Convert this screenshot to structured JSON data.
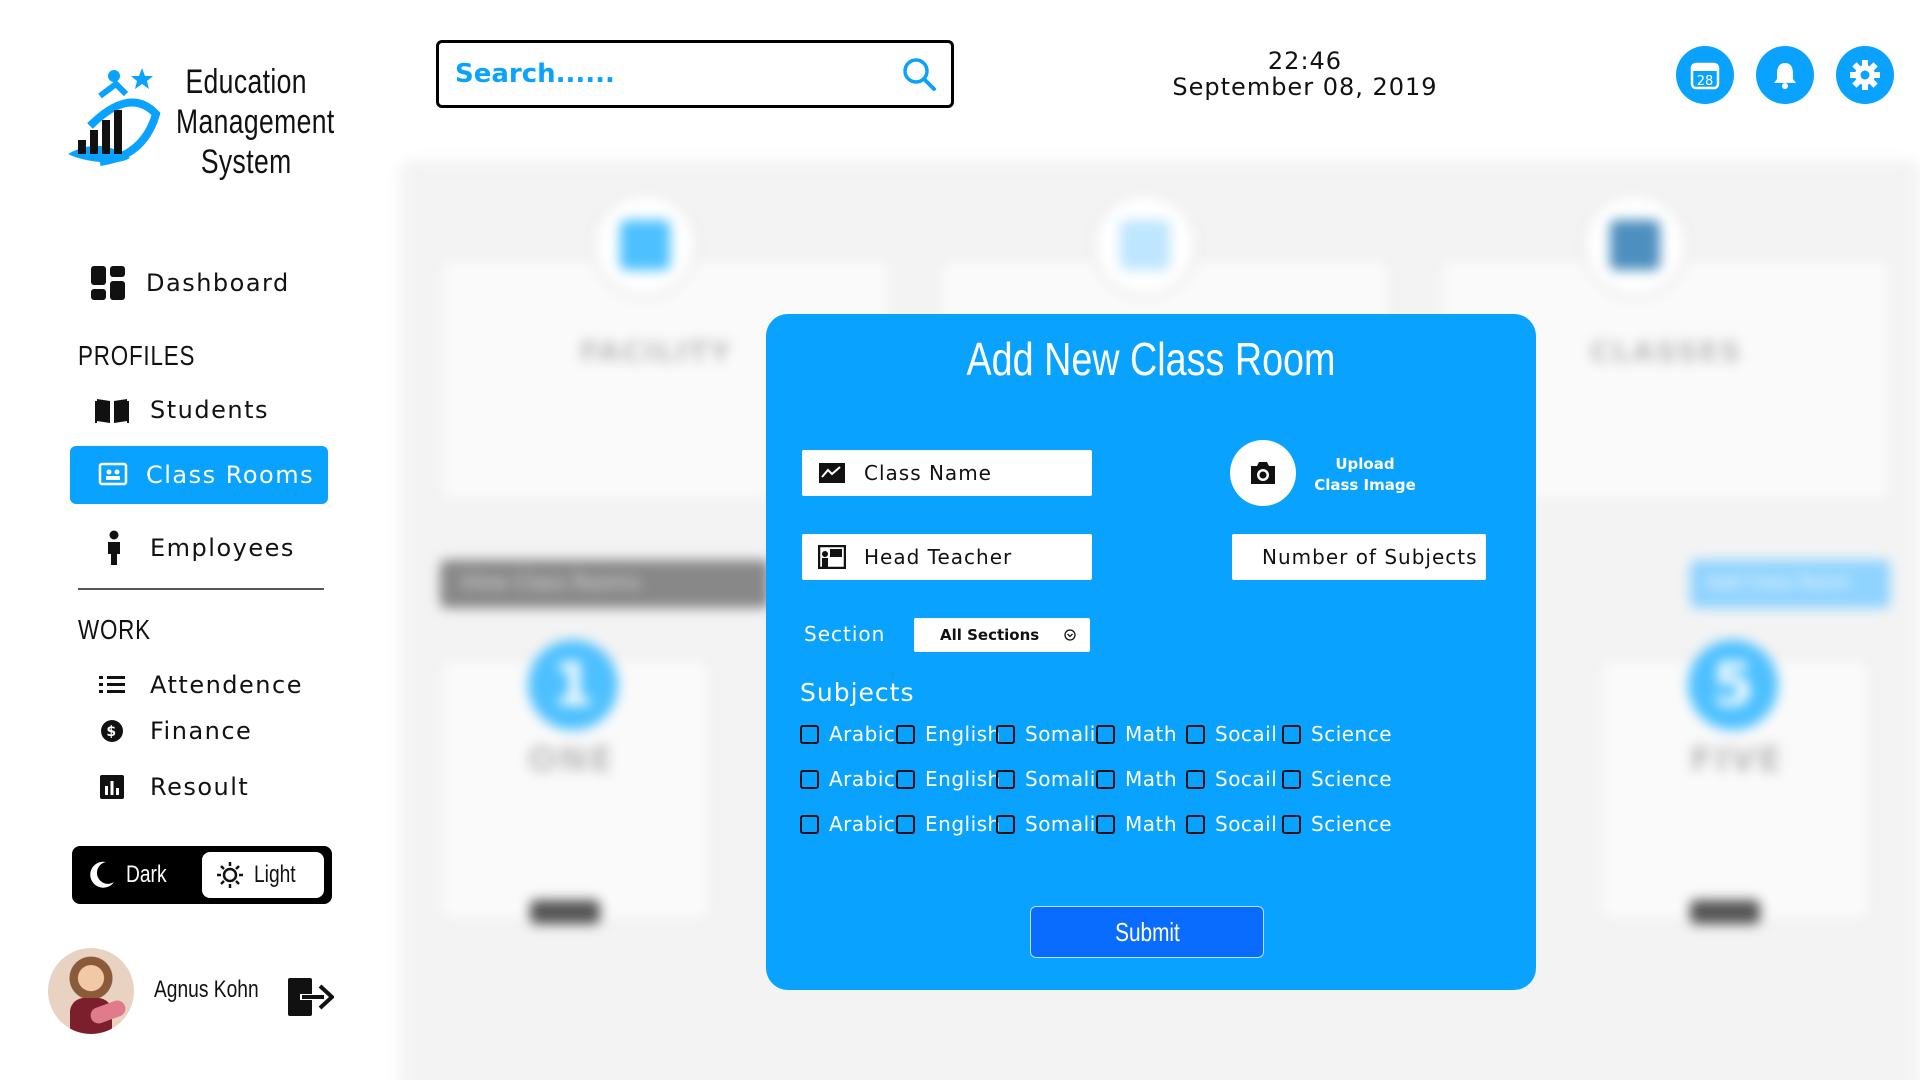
{
  "brand": {
    "line1": "Education",
    "line2": "Management",
    "line3": "System"
  },
  "sidebar": {
    "dashboard": "Dashboard",
    "profiles_heading": "PROFILES",
    "students": "Students",
    "class_rooms": "Class Rooms",
    "employees": "Employees",
    "work_heading": "WORK",
    "attendence": "Attendence",
    "finance": "Finance",
    "resoult": "Resoult"
  },
  "theme": {
    "dark_label": "Dark",
    "light_label": "Light",
    "selected": "Light"
  },
  "user": {
    "name": "Agnus Kohn"
  },
  "header": {
    "search_placeholder": "Search......",
    "time": "22:46",
    "date": "September 08, 2019",
    "calendar_day": "28",
    "accent_color": "#0aa2ff"
  },
  "background": {
    "card1_title": "FACILITY",
    "card2_title": "CLASSES",
    "left_button": "View Class Rooms",
    "right_button": "Add Class Room",
    "class1_number": "1",
    "class1_name": "ONE",
    "class5_number": "5",
    "class5_name": "FIVE"
  },
  "modal": {
    "title": "Add New Class Room",
    "class_name_placeholder": "Class Name",
    "head_teacher_placeholder": "Head Teacher",
    "number_of_subjects_placeholder": "Number of Subjects",
    "upload_line1": "Upload",
    "upload_line2": "Class Image",
    "section_label": "Section",
    "section_value": "All Sections",
    "subjects_label": "Subjects",
    "subject_rows": [
      [
        "Arabic",
        "English",
        "Somali",
        "Math",
        "Socail",
        "Science"
      ],
      [
        "Arabic",
        "English",
        "Somali",
        "Math",
        "Socail",
        "Science"
      ],
      [
        "Arabic",
        "English",
        "Somali",
        "Math",
        "Socail",
        "Science"
      ]
    ],
    "submit_label": "Submit"
  }
}
